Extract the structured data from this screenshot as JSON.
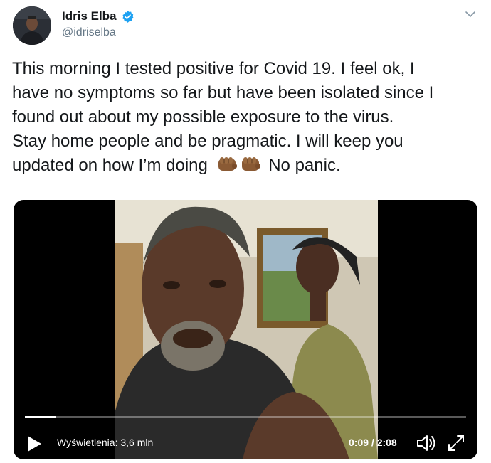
{
  "author": {
    "name": "Idris Elba",
    "handle": "@idriselba",
    "verified": true,
    "avatar_icon": "avatar-photo-icon",
    "verified_icon": "verified-badge-icon",
    "verified_color": "#1da1f2"
  },
  "menu_icon": "chevron-down-icon",
  "tweet": {
    "lines": [
      "This morning I tested positive for Covid 19. I feel ok, I",
      "have no symptoms so far but have been isolated since I",
      "found out about my possible exposure to the virus.",
      "Stay home people and be pragmatic. I will keep you"
    ],
    "last_line_start": "updated on how I’m doing",
    "emoji_icons": [
      "oncoming-fist-icon",
      "oncoming-fist-icon"
    ],
    "last_line_end": "No panic."
  },
  "video": {
    "views_label": "Wyświetlenia: 3,6 mln",
    "current_time": "0:09",
    "duration": "2:08",
    "time_label": "0:09 / 2:08",
    "progress": 0.07,
    "play_icon": "play-icon",
    "volume_icon": "volume-icon",
    "fullscreen_icon": "fullscreen-icon"
  }
}
